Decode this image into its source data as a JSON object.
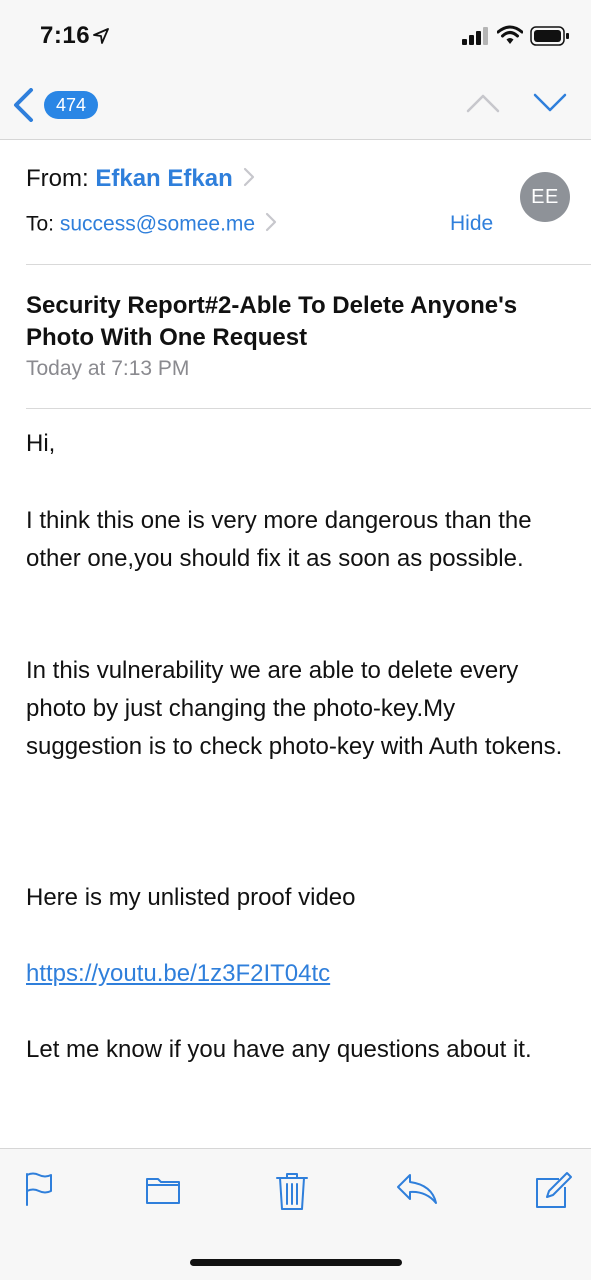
{
  "status_bar": {
    "time": "7:16",
    "icons": [
      "location-arrow-icon",
      "signal-icon",
      "wifi-icon",
      "battery-icon"
    ]
  },
  "nav": {
    "message_count": "474",
    "icons": [
      "back-chevron-icon",
      "previous-message-icon",
      "next-message-icon"
    ]
  },
  "header": {
    "from_label": "From:",
    "from_name": "Efkan Efkan",
    "to_label": "To:",
    "to_address": "success@somee.me",
    "hide_label": "Hide",
    "avatar_initials": "EE"
  },
  "message": {
    "subject": "Security Report#2-Able To Delete Anyone's Photo With One Request",
    "date": "Today at 7:13 PM",
    "greeting": "Hi,",
    "paragraph1": "I think this one is very more dangerous than the other one,you should fix it as soon as possible.",
    "paragraph2": "In this vulnerability we are able to delete every photo by just changing the photo-key.My suggestion is to check photo-key with Auth tokens.",
    "paragraph3": "Here is my unlisted proof video",
    "link": "https://youtu.be/1z3F2IT04tc",
    "paragraph4": "Let me know if you have any questions about it."
  },
  "toolbar": {
    "icons": [
      "flag-icon",
      "folder-icon",
      "trash-icon",
      "reply-icon",
      "compose-icon"
    ]
  },
  "colors": {
    "accent": "#2f7fdb",
    "badge": "#2a86e5",
    "avatar": "#8e9298",
    "bar_background": "#f7f7f7",
    "secondary_text": "#8a8a8f"
  }
}
